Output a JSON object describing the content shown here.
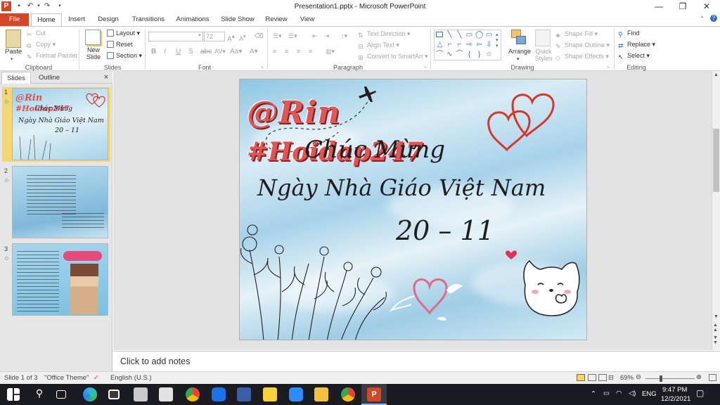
{
  "window": {
    "title": "Presentation1.pptx - Microsoft PowerPoint"
  },
  "tabs": [
    {
      "label": "File"
    },
    {
      "label": "Home"
    },
    {
      "label": "Insert"
    },
    {
      "label": "Design"
    },
    {
      "label": "Transitions"
    },
    {
      "label": "Animations"
    },
    {
      "label": "Slide Show"
    },
    {
      "label": "Review"
    },
    {
      "label": "View"
    }
  ],
  "ribbon": {
    "clipboard": {
      "label": "Clipboard",
      "paste": "Paste",
      "cut": "Cut",
      "copy": "Copy",
      "format_painter": "Format Painter"
    },
    "slides": {
      "label": "Slides",
      "new_slide": "New Slide",
      "layout": "Layout",
      "reset": "Reset",
      "section": "Section"
    },
    "font": {
      "label": "Font",
      "font_name": "",
      "font_size": "72"
    },
    "paragraph": {
      "label": "Paragraph",
      "text_direction": "Text Direction",
      "align_text": "Align Text",
      "convert_smartart": "Convert to SmartArt"
    },
    "drawing": {
      "label": "Drawing",
      "arrange": "Arrange",
      "quick_styles": "Quick Styles",
      "shape_fill": "Shape Fill",
      "shape_outline": "Shape Outline",
      "shape_effects": "Shape Effects"
    },
    "editing": {
      "label": "Editing",
      "find": "Find",
      "replace": "Replace",
      "select": "Select"
    }
  },
  "pane": {
    "tab_slides": "Slides",
    "tab_outline": "Outline",
    "close": "×"
  },
  "thumbnails": [
    {
      "number": "1"
    },
    {
      "number": "2"
    },
    {
      "number": "3"
    }
  ],
  "slide": {
    "handle": "@Rin",
    "hashtag": "#Hoidap247",
    "greeting": "Chúc Mừng",
    "title": "Ngày Nhà Giáo Việt Nam",
    "date": "20 – 11"
  },
  "notes": {
    "placeholder": "Click to add notes"
  },
  "status": {
    "slide_info": "Slide 1 of 3",
    "theme": "\"Office Theme\"",
    "language": "English (U.S.)",
    "zoom": "69%"
  },
  "taskbar": {
    "lang": "ENG",
    "time": "9:47 PM",
    "date": "12/2/2021"
  },
  "colors": {
    "file_tab": "#d24726",
    "heart_red": "#d9362b",
    "wordart_red": "#e05555"
  }
}
